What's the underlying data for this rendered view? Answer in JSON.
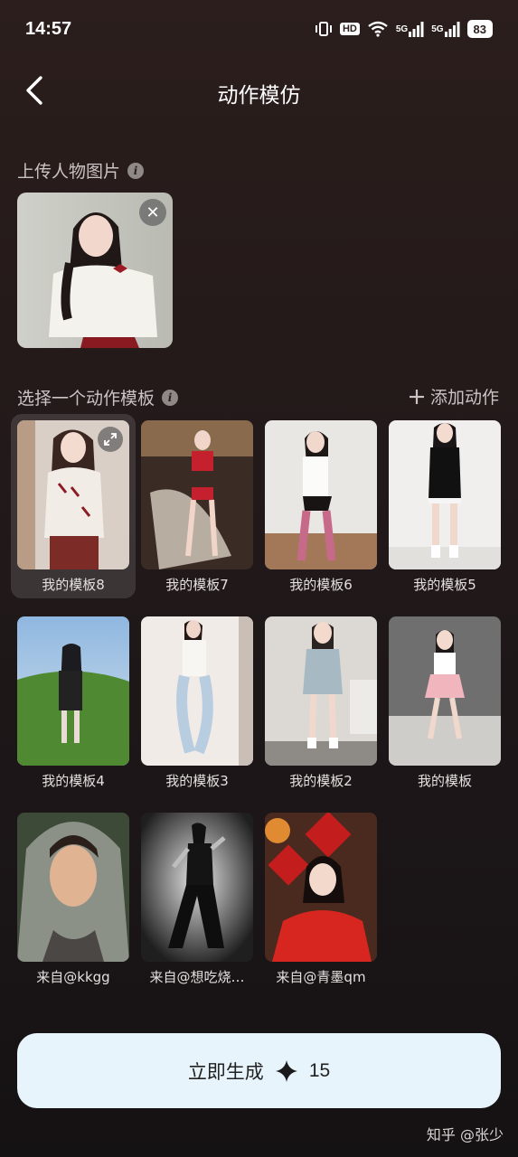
{
  "status_bar": {
    "time": "14:57",
    "hd_label": "HD",
    "signal_1": "5G",
    "signal_2": "5G",
    "battery": "83",
    "icons": [
      "vibrate-icon",
      "hd-icon",
      "wifi-icon",
      "signal-icon",
      "signal-icon",
      "battery-icon"
    ]
  },
  "header": {
    "title": "动作模仿",
    "back_icon": "chevron-left-icon"
  },
  "upload": {
    "label": "上传人物图片",
    "info_icon": "info-icon",
    "remove_icon": "close-icon"
  },
  "templates": {
    "label": "选择一个动作模板",
    "add_label": "添加动作",
    "add_icon": "plus-icon",
    "selected_index": 0,
    "items": [
      {
        "label": "我的模板8"
      },
      {
        "label": "我的模板7"
      },
      {
        "label": "我的模板6"
      },
      {
        "label": "我的模板5"
      },
      {
        "label": "我的模板4"
      },
      {
        "label": "我的模板3"
      },
      {
        "label": "我的模板2"
      },
      {
        "label": "我的模板"
      },
      {
        "label": "来自@kkgg"
      },
      {
        "label": "来自@想吃烧…"
      },
      {
        "label": "来自@青墨qm"
      }
    ]
  },
  "generate": {
    "label": "立即生成",
    "cost_icon": "sparkle-icon",
    "cost": "15"
  },
  "watermark": "知乎 @张少"
}
